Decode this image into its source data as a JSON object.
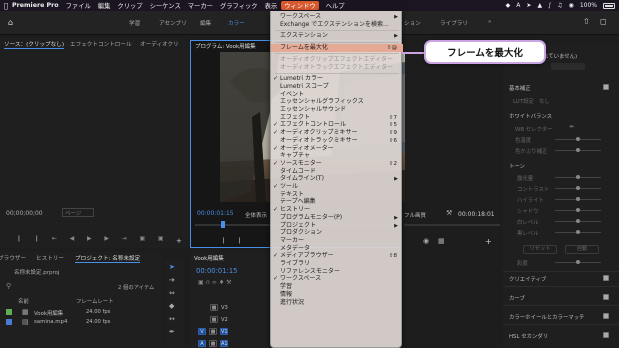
{
  "menubar": {
    "app_name": "Premiere Pro",
    "items": [
      "ファイル",
      "編集",
      "クリップ",
      "シーケンス",
      "マーカー",
      "グラフィック",
      "表示",
      "ウィンドウ",
      "ヘルプ"
    ],
    "active_item": "ウィンドウ",
    "battery": "100%",
    "status_icons": [
      "dropbox-icon",
      "font-icon",
      "arrow-icon",
      "ticket-icon",
      "bluetooth-icon",
      "volume-icon",
      "wifi-icon",
      "battery-icon"
    ]
  },
  "workspaces": {
    "tabs": [
      "学習",
      "アセンブリ",
      "編集",
      "カラー",
      "ラリー"
    ],
    "selected": "カラー",
    "more": "»"
  },
  "source_panel": {
    "tabs": [
      "ソース：(クリップなし)",
      "エフェクトコントロール",
      "オーディオクリ"
    ],
    "timecode": "00;00;00;00",
    "page_field": "ページ"
  },
  "program_panel": {
    "title": "プログラム: Vook用編集",
    "timecode_left": "00:00:01:15",
    "fit": "全体表示",
    "quality": "フル画質",
    "timecode_right": "00:00:18:01"
  },
  "project_panel": {
    "tabs": [
      "ブラウザー",
      "ヒストリー",
      "プロジェクト: 名称未設定"
    ],
    "project_file": "名称未設定.prproj",
    "item_count": "2 個のアイテム",
    "columns": [
      "名前",
      "フレームレート"
    ],
    "rows": [
      {
        "name": "Vook用編集",
        "fps": "24.00 fps",
        "color": "#5fae57"
      },
      {
        "name": "samina.mp4",
        "fps": "24.00 fps",
        "color": "#4a7bd0"
      }
    ]
  },
  "timeline_panel": {
    "title": "Vook用編集",
    "timecode": "00:00:01:15",
    "video_tracks": [
      "V3",
      "V2",
      "V1"
    ],
    "audio_tracks": [
      "A1",
      "A2"
    ]
  },
  "window_menu": {
    "items": [
      {
        "label": "ワークスペース",
        "check": false,
        "shortcut": "",
        "submenu": true,
        "disabled": false,
        "highlight": false
      },
      {
        "label": "Exchange でエクステンションを検索...",
        "check": false,
        "shortcut": "",
        "submenu": false,
        "disabled": false,
        "highlight": false
      },
      {
        "sep": true
      },
      {
        "label": "エクステンション",
        "check": false,
        "shortcut": "",
        "submenu": true,
        "disabled": false,
        "highlight": false
      },
      {
        "sep": true
      },
      {
        "label": "フレームを最大化",
        "check": false,
        "shortcut": "⇧@",
        "submenu": false,
        "disabled": false,
        "highlight": true
      },
      {
        "sep": true
      },
      {
        "label": "オーディオクリップエフェクトエディター",
        "check": false,
        "shortcut": "",
        "submenu": false,
        "disabled": true,
        "highlight": false
      },
      {
        "label": "オーディオトラックエフェクトエディター",
        "check": false,
        "shortcut": "",
        "submenu": false,
        "disabled": true,
        "highlight": false
      },
      {
        "sep": true
      },
      {
        "label": "Lumetri カラー",
        "check": true,
        "shortcut": "",
        "submenu": false,
        "disabled": false,
        "highlight": false
      },
      {
        "label": "Lumetri スコープ",
        "check": false,
        "shortcut": "",
        "submenu": false,
        "disabled": false,
        "highlight": false
      },
      {
        "label": "イベント",
        "check": false,
        "shortcut": "",
        "submenu": false,
        "disabled": false,
        "highlight": false
      },
      {
        "label": "エッセンシャルグラフィックス",
        "check": false,
        "shortcut": "",
        "submenu": false,
        "disabled": false,
        "highlight": false
      },
      {
        "label": "エッセンシャルサウンド",
        "check": false,
        "shortcut": "",
        "submenu": false,
        "disabled": false,
        "highlight": false
      },
      {
        "label": "エフェクト",
        "check": false,
        "shortcut": "⇧7",
        "submenu": false,
        "disabled": false,
        "highlight": false
      },
      {
        "label": "エフェクトコントロール",
        "check": true,
        "shortcut": "⇧5",
        "submenu": false,
        "disabled": false,
        "highlight": false
      },
      {
        "label": "オーディオクリップミキサー",
        "check": true,
        "shortcut": "⇧9",
        "submenu": false,
        "disabled": false,
        "highlight": false
      },
      {
        "label": "オーディオトラックミキサー",
        "check": false,
        "shortcut": "⇧6",
        "submenu": false,
        "disabled": false,
        "highlight": false
      },
      {
        "label": "オーディオメーター",
        "check": true,
        "shortcut": "",
        "submenu": false,
        "disabled": false,
        "highlight": false
      },
      {
        "label": "キャプチャ",
        "check": false,
        "shortcut": "",
        "submenu": false,
        "disabled": false,
        "highlight": false
      },
      {
        "label": "ソースモニター",
        "check": true,
        "shortcut": "⇧2",
        "submenu": false,
        "disabled": false,
        "highlight": false
      },
      {
        "label": "タイムコード",
        "check": false,
        "shortcut": "",
        "submenu": false,
        "disabled": false,
        "highlight": false
      },
      {
        "label": "タイムライン(T)",
        "check": false,
        "shortcut": "",
        "submenu": true,
        "disabled": false,
        "highlight": false
      },
      {
        "label": "ツール",
        "check": true,
        "shortcut": "",
        "submenu": false,
        "disabled": false,
        "highlight": false
      },
      {
        "label": "テキスト",
        "check": false,
        "shortcut": "",
        "submenu": false,
        "disabled": false,
        "highlight": false
      },
      {
        "label": "テープへ編集",
        "check": false,
        "shortcut": "",
        "submenu": false,
        "disabled": false,
        "highlight": false
      },
      {
        "label": "ヒストリー",
        "check": true,
        "shortcut": "",
        "submenu": false,
        "disabled": false,
        "highlight": false
      },
      {
        "label": "プログラムモニター(P)",
        "check": false,
        "shortcut": "",
        "submenu": true,
        "disabled": false,
        "highlight": false
      },
      {
        "label": "プロジェクト",
        "check": false,
        "shortcut": "",
        "submenu": true,
        "disabled": false,
        "highlight": false
      },
      {
        "label": "プロダクション",
        "check": false,
        "shortcut": "",
        "submenu": false,
        "disabled": false,
        "highlight": false
      },
      {
        "label": "マーカー",
        "check": false,
        "shortcut": "",
        "submenu": false,
        "disabled": false,
        "highlight": false
      },
      {
        "label": "メタデータ",
        "check": false,
        "shortcut": "",
        "submenu": false,
        "disabled": false,
        "highlight": false
      },
      {
        "label": "メディアブラウザー",
        "check": true,
        "shortcut": "⇧8",
        "submenu": false,
        "disabled": false,
        "highlight": false
      },
      {
        "label": "ライブラリ",
        "check": false,
        "shortcut": "",
        "submenu": false,
        "disabled": false,
        "highlight": false
      },
      {
        "label": "リファレンスモニター",
        "check": false,
        "shortcut": "",
        "submenu": false,
        "disabled": false,
        "highlight": false
      },
      {
        "label": "ワークスペース",
        "check": true,
        "shortcut": "",
        "submenu": false,
        "disabled": false,
        "highlight": false
      },
      {
        "label": "学習",
        "check": false,
        "shortcut": "",
        "submenu": false,
        "disabled": false,
        "highlight": false
      },
      {
        "label": "情報",
        "check": false,
        "shortcut": "",
        "submenu": false,
        "disabled": false,
        "highlight": false
      },
      {
        "label": "進行状況",
        "check": false,
        "shortcut": "",
        "submenu": false,
        "disabled": false,
        "highlight": false
      }
    ]
  },
  "callout": {
    "text": "フレームを最大化"
  },
  "workspace_right_tabs": [
    "ション",
    "ライブラリ",
    "»"
  ],
  "lumetri": {
    "header": "れていません)",
    "basic": "基本補正",
    "lut_label": "LUT設定",
    "lut_value": "なし",
    "white_balance": "ホワイトバランス",
    "wb_selector": "WB セレクター",
    "temperature": "色温度",
    "tint": "色かぶり補正",
    "tone": "トーン",
    "tone_items": [
      "露光量",
      "コントラスト",
      "ハイライト",
      "シャドウ",
      "白レベル",
      "黒レベル"
    ],
    "reset": "リセット",
    "auto": "自動",
    "saturation": "彩度",
    "sections": [
      "クリエイティブ",
      "カーブ",
      "カラーホイールとカラーマッチ",
      "HSL セカンダリ"
    ]
  },
  "colors": {
    "accent_blue": "#4a8fe7",
    "menu_active": "#d9592f",
    "menu_highlight": "#e4aa96",
    "callout_border": "#c9a3e2"
  }
}
